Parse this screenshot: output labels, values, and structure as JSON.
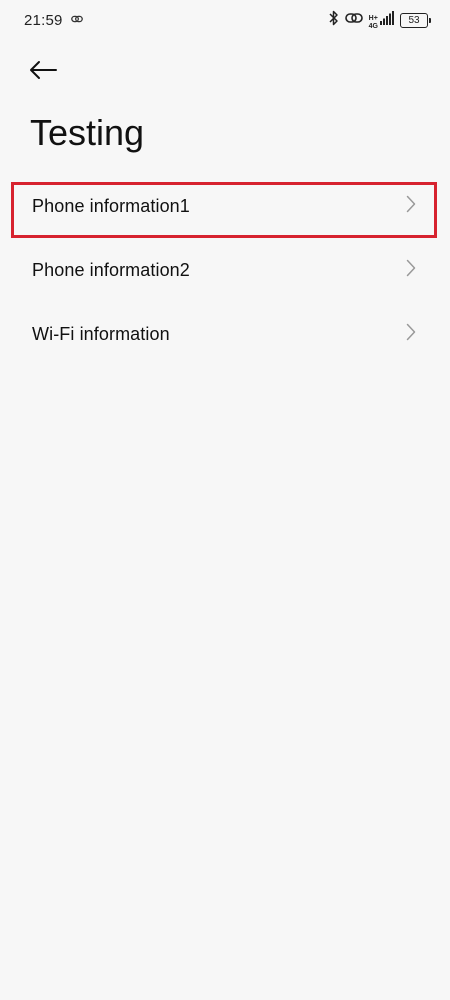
{
  "status_bar": {
    "time": "21:59",
    "network_label_top": "H+",
    "network_label_bottom": "4G",
    "battery_level": "53"
  },
  "header": {
    "title": "Testing"
  },
  "menu": {
    "items": [
      {
        "label": "Phone information1"
      },
      {
        "label": "Phone information2"
      },
      {
        "label": "Wi-Fi information"
      }
    ]
  },
  "highlight": {
    "target": "Phone information1",
    "color": "#d7232f"
  }
}
